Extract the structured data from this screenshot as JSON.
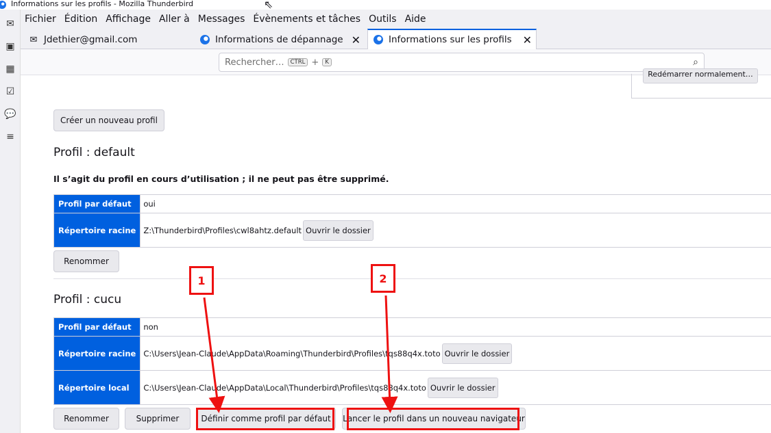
{
  "window": {
    "title": "Informations sur les profils - Mozilla Thunderbird"
  },
  "menubar": [
    "Fichier",
    "Édition",
    "Affichage",
    "Aller à",
    "Messages",
    "Évènements et tâches",
    "Outils",
    "Aide"
  ],
  "tabs": [
    {
      "label": "Jdethier@gmail.com"
    },
    {
      "label": "Informations de dépannage"
    },
    {
      "label": "Informations sur les profils"
    }
  ],
  "search": {
    "placeholder": "Rechercher…",
    "key1": "CTRL",
    "plus": "+",
    "key2": "K"
  },
  "restart_label": "Redémarrer normalement…",
  "create_button": "Créer un nouveau profil",
  "profile1": {
    "title": "Profil : default",
    "note": "Il s’agit du profil en cours d’utilisation ; il ne peut pas être supprimé.",
    "default_label": "Profil par défaut",
    "default_value": "oui",
    "root_label": "Répertoire racine",
    "root_value": "Z:\\Thunderbird\\Profiles\\cwl8ahtz.default",
    "open_folder": "Ouvrir le dossier",
    "rename": "Renommer"
  },
  "profile2": {
    "title": "Profil : cucu",
    "default_label": "Profil par défaut",
    "default_value": "non",
    "root_label": "Répertoire racine",
    "root_value": "C:\\Users\\Jean-Claude\\AppData\\Roaming\\Thunderbird\\Profiles\\tqs88q4x.toto",
    "local_label": "Répertoire local",
    "local_value": "C:\\Users\\Jean-Claude\\AppData\\Local\\Thunderbird\\Profiles\\tqs88q4x.toto",
    "open_folder": "Ouvrir le dossier",
    "rename": "Renommer",
    "delete": "Supprimer",
    "set_default": "Définir comme profil par défaut",
    "launch": "Lancer le profil dans un nouveau navigateur"
  },
  "annotations": {
    "badge1": "1",
    "badge2": "2",
    "color": "#e11111"
  },
  "icons": [
    "mail-icon",
    "address-book-icon",
    "calendar-icon",
    "tasks-icon",
    "chat-icon",
    "accounts-icon",
    "search-icon",
    "close-icon",
    "thunderbird-icon"
  ]
}
